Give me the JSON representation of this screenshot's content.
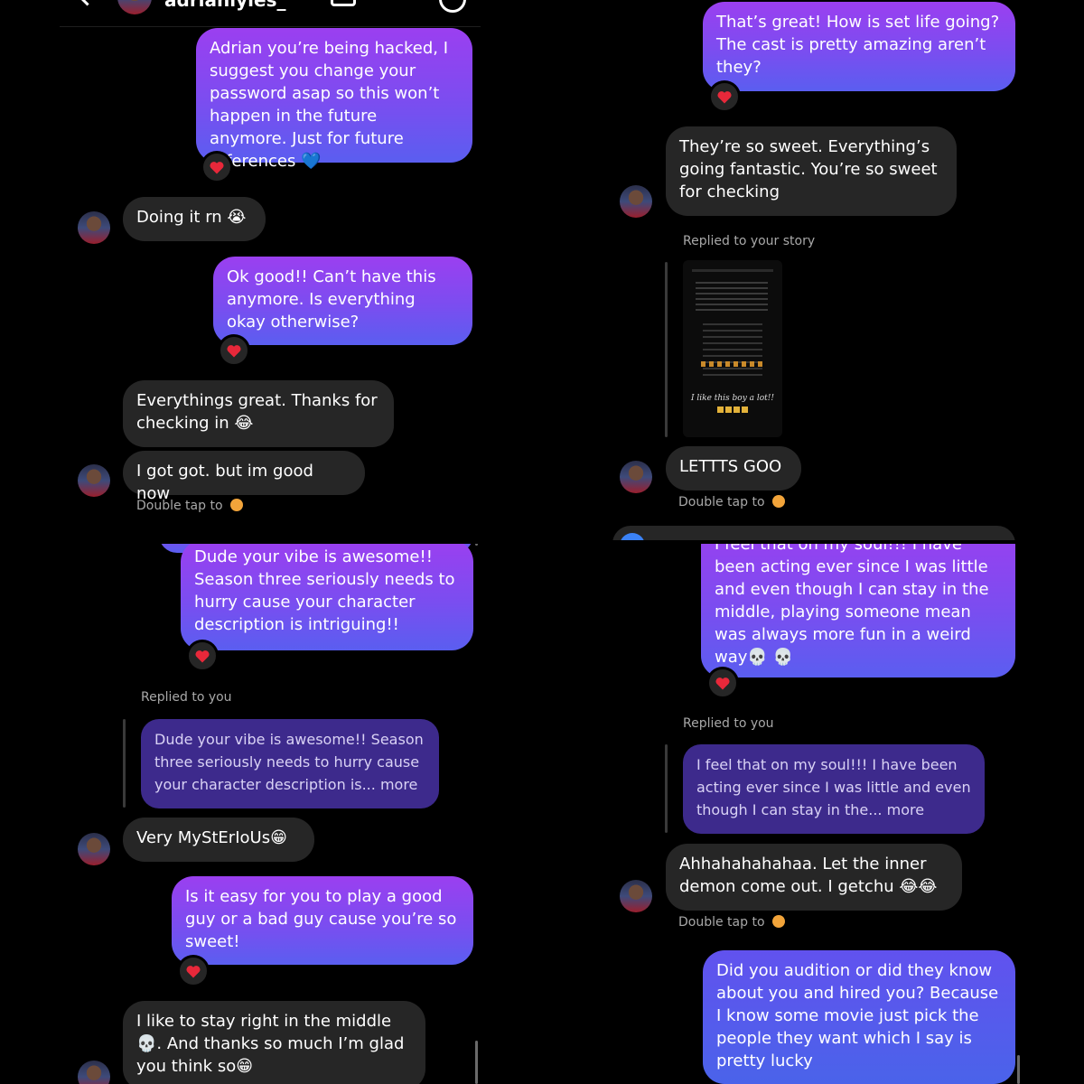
{
  "colors": {
    "sent_top": "#9b3ff0",
    "sent_bottom": "#5a5ef0",
    "received": "#262626",
    "heart": "#e8283a",
    "background": "#000000"
  },
  "panel1": {
    "header_username": "adrianlyles_",
    "messages": [
      {
        "text": "Adrian you’re being hacked, I suggest you change your password asap so this won’t happen in the future anymore. Just for future references 💙"
      },
      {
        "text": "Doing it rn 😭"
      },
      {
        "text": "Ok good!! Can’t have this anymore. Is everything okay otherwise?"
      },
      {
        "text": "Everythings great. Thanks for checking in 😂"
      },
      {
        "text": "I got got. but im good now"
      }
    ],
    "double_tap": "Double tap to"
  },
  "panel2": {
    "messages": [
      {
        "text": "That’s great! How is set life going? The cast is pretty amazing aren’t they?"
      },
      {
        "text": "They’re so sweet. Everything’s going fantastic. You’re so sweet for checking"
      },
      {
        "text": "LETTTS GOO"
      }
    ],
    "story_label": "Replied to your story",
    "story_caption": "I like this boy a lot!!",
    "double_tap": "Double tap to"
  },
  "panel3": {
    "messages": [
      {
        "text": "Dude your vibe is awesome!! Season three seriously needs to hurry cause your character description is intriguing!!"
      },
      {
        "text": "Very MyStErIoUs😁"
      },
      {
        "text": "Is it easy for you to play a good guy or a bad guy cause you’re so sweet!"
      },
      {
        "text": "I like to stay right in the middle 💀. And thanks so much I’m glad you think so😁"
      }
    ],
    "replied_label": "Replied to you",
    "quote": "Dude your vibe is awesome!! Season three seriously needs to hurry cause your character description is... more"
  },
  "panel4": {
    "messages": [
      {
        "text": "I feel that on my soul!!! I have been acting ever since I was little and even though I can stay in the middle, playing someone mean was always more fun in a weird way💀 💀"
      },
      {
        "text": "Ahhahahahahaa. Let the inner demon come out. I getchu 😂😂"
      },
      {
        "text": "Did you audition or did they know about you and hired you? Because I know some movie just pick the people they want which I say is pretty lucky"
      }
    ],
    "replied_label": "Replied to you",
    "quote": "I feel that on my soul!!! I have been acting ever since I was little and even though I can stay in the... more",
    "double_tap": "Double tap to"
  }
}
